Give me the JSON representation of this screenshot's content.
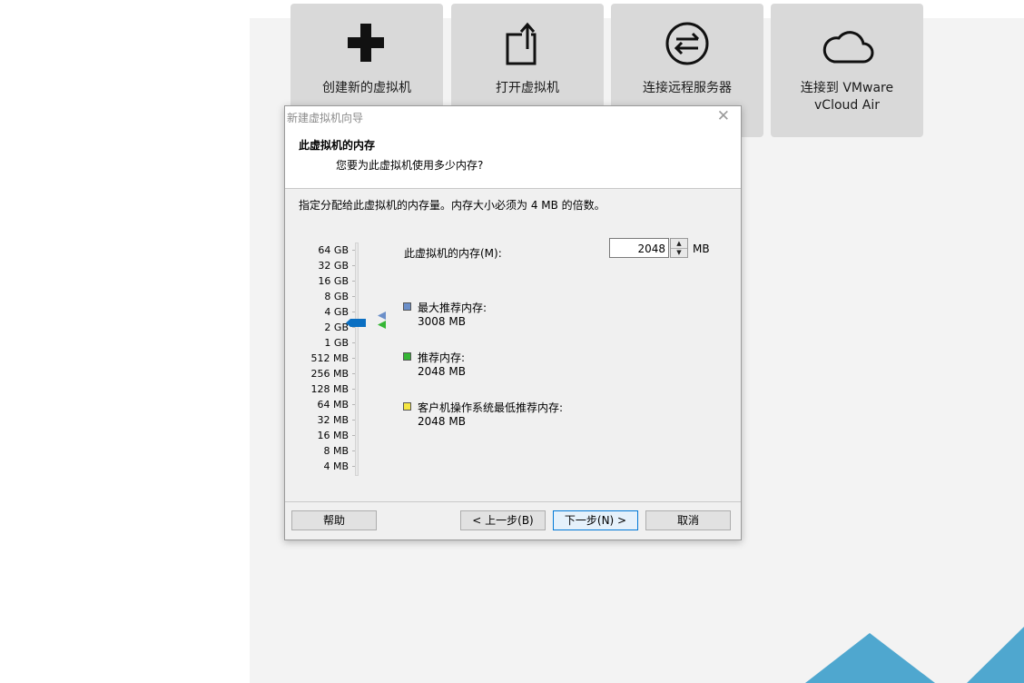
{
  "tiles": [
    {
      "label": "创建新的虚拟机",
      "icon": "plus-icon"
    },
    {
      "label": "打开虚拟机",
      "icon": "open-vm-icon"
    },
    {
      "label": "连接远程服务器",
      "icon": "remote-server-icon"
    },
    {
      "label_line1": "连接到 VMware",
      "label_line2": "vCloud Air",
      "icon": "cloud-icon"
    }
  ],
  "dialog": {
    "title": "新建虚拟机向导",
    "close": "✕",
    "heading": "此虚拟机的内存",
    "subheading": "您要为此虚拟机使用多少内存?",
    "description": "指定分配给此虚拟机的内存量。内存大小必须为 4 MB 的倍数。",
    "memory_label": "此虚拟机的内存(M):",
    "memory_value": "2048",
    "memory_unit": "MB",
    "scale": [
      "64 GB",
      "32 GB",
      "16 GB",
      "8 GB",
      "4 GB",
      "2 GB",
      "1 GB",
      "512 MB",
      "256 MB",
      "128 MB",
      "64 MB",
      "32 MB",
      "16 MB",
      "8 MB",
      "4 MB"
    ],
    "selected_scale": "2 GB",
    "legend": [
      {
        "title": "最大推荐内存:",
        "value": "3008 MB",
        "color": "#6b8fc9"
      },
      {
        "title": "推荐内存:",
        "value": "2048 MB",
        "color": "#35b635"
      },
      {
        "title": "客户机操作系统最低推荐内存:",
        "value": "2048 MB",
        "color": "#f5e642"
      }
    ],
    "buttons": {
      "help": "帮助",
      "back": "< 上一步(B)",
      "next": "下一步(N) >",
      "cancel": "取消"
    }
  },
  "colors": {
    "accent": "#0078d7",
    "thumb": "#0a6fc2",
    "brand_triangle": "#4fa7cf"
  }
}
